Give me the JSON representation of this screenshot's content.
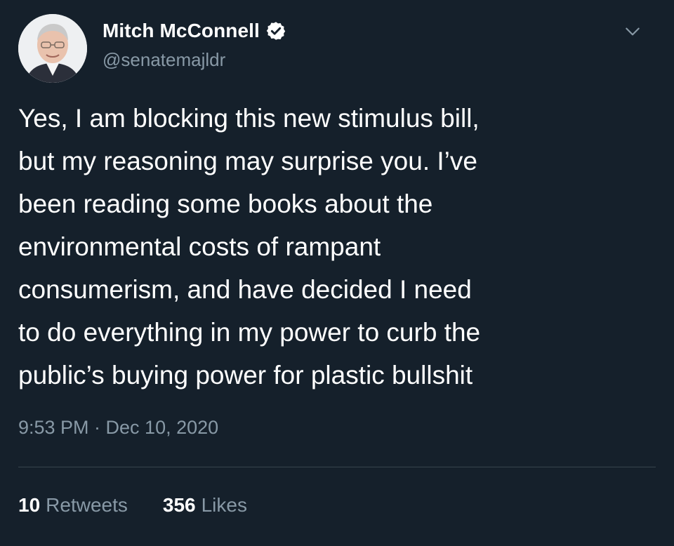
{
  "author": {
    "display_name": "Mitch McConnell",
    "handle": "@senatemajldr",
    "verified_icon": "verified-badge-icon",
    "avatar_icon": "avatar"
  },
  "tweet": {
    "text": "Yes, I am blocking this new stimulus bill,\nbut my reasoning may surprise you. I’ve\nbeen reading some books about the\nenvironmental costs of rampant\nconsumerism, and have decided I need\nto do everything in my power to curb the\npublic’s buying power for plastic bullshit",
    "timestamp": "9:53 PM · Dec 10, 2020"
  },
  "stats": {
    "retweets_count": "10",
    "retweets_label": "Retweets",
    "likes_count": "356",
    "likes_label": "Likes"
  },
  "colors": {
    "background": "#15202b",
    "secondary_text": "#8899a6",
    "divider": "#38444d",
    "verified": "#ffffff"
  }
}
